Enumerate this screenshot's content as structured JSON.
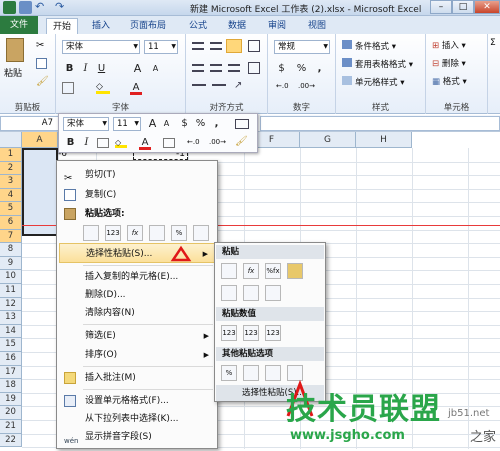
{
  "window": {
    "title": "新建 Microsoft Excel 工作表 (2).xlsx - Microsoft Excel",
    "min": "–",
    "max": "□",
    "close": "✕"
  },
  "tabs": [
    "文件",
    "开始",
    "插入",
    "页面布局",
    "公式",
    "数据",
    "审阅",
    "视图"
  ],
  "ribbon": {
    "clipboard": {
      "label": "剪贴板",
      "paste": "粘贴"
    },
    "font": {
      "label": "字体",
      "name": "宋体",
      "size": "11",
      "bold": "B",
      "italic": "I",
      "underline": "U",
      "grow": "A",
      "shrink": "A",
      "color_a": "A"
    },
    "alignment": {
      "label": "对齐方式"
    },
    "number": {
      "label": "数字",
      "format": "常规",
      "currency": "$",
      "percent": "%",
      "comma": ","
    },
    "styles": {
      "label": "样式",
      "items": [
        "条件格式",
        "套用表格格式",
        "单元格样式"
      ]
    },
    "cells": {
      "label": "单元格",
      "items": [
        "插入",
        "删除",
        "格式"
      ]
    }
  },
  "formula_bar": {
    "name_box": "A7"
  },
  "mini_toolbar": {
    "font": "宋体",
    "size": "11",
    "bold": "B",
    "italic": "I",
    "percent": "%",
    "comma": ","
  },
  "grid": {
    "columns": [
      "A",
      "B",
      "C",
      "D",
      "E",
      "F",
      "G",
      "H"
    ],
    "rows": [
      "1",
      "2",
      "3",
      "4",
      "5",
      "6",
      "7",
      "8",
      "9",
      "10",
      "11",
      "12",
      "13",
      "14",
      "15",
      "16",
      "17",
      "18",
      "19",
      "20",
      "21",
      "22"
    ],
    "cell_a1": "-6",
    "cell_c1": "-1"
  },
  "context_menu": {
    "items": [
      "剪切(T)",
      "复制(C)",
      "粘贴选项:",
      "选择性粘贴(S)...",
      "插入复制的单元格(E)...",
      "删除(D)...",
      "清除内容(N)",
      "筛选(E)",
      "排序(O)",
      "插入批注(M)",
      "设置单元格格式(F)...",
      "从下拉列表中选择(K)...",
      "显示拼音字段(S)"
    ],
    "paste_icons": [
      "",
      "123",
      "fx",
      "",
      "%",
      ""
    ]
  },
  "submenu": {
    "headers": [
      "粘贴",
      "粘贴数值",
      "其他粘贴选项"
    ],
    "paste_icons": [
      "",
      "fx",
      "%fx",
      "",
      "",
      "",
      ""
    ],
    "value_icons": [
      "123",
      "123",
      "123"
    ],
    "other_icons": [
      "%",
      "",
      "",
      ""
    ],
    "footer": "选择性粘贴(S)..."
  },
  "watermark": {
    "big": "技术员联盟",
    "url1": "jb51.net",
    "url2": "www.jsgho.com",
    "suffix": "之家"
  }
}
